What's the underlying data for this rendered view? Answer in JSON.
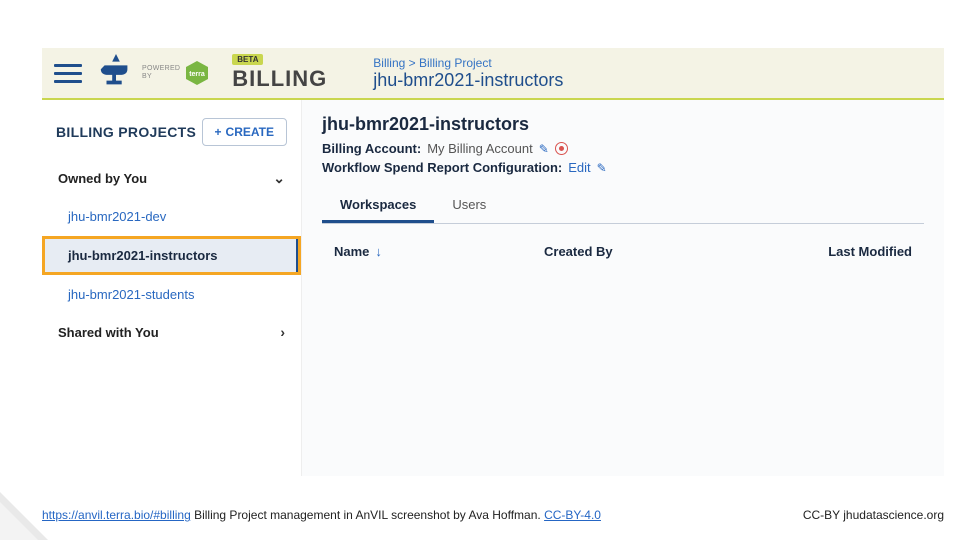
{
  "header": {
    "powered_by": "POWERED\nBY",
    "beta": "BETA",
    "title": "BILLING",
    "breadcrumb_parent": "Billing",
    "breadcrumb_sep": " > ",
    "breadcrumb_current": "Billing Project",
    "subtitle": "jhu-bmr2021-instructors"
  },
  "sidebar": {
    "title": "BILLING PROJECTS",
    "create_label": "CREATE",
    "sections": {
      "owned": "Owned by You",
      "shared": "Shared with You"
    },
    "projects": [
      {
        "name": "jhu-bmr2021-dev",
        "selected": false
      },
      {
        "name": "jhu-bmr2021-instructors",
        "selected": true
      },
      {
        "name": "jhu-bmr2021-students",
        "selected": false
      }
    ]
  },
  "main": {
    "title": "jhu-bmr2021-instructors",
    "billing_account_label": "Billing Account:",
    "billing_account_value": "My Billing Account",
    "workflow_label": "Workflow Spend Report Configuration:",
    "workflow_edit": "Edit",
    "tabs": [
      {
        "label": "Workspaces",
        "active": true
      },
      {
        "label": "Users",
        "active": false
      }
    ],
    "columns": {
      "name": "Name",
      "created": "Created By",
      "modified": "Last Modified"
    }
  },
  "caption": {
    "url": "https://anvil.terra.bio/#billing",
    "text": " Billing Project management in AnVIL screenshot by Ava Hoffman.  ",
    "license": "CC-BY-4.0",
    "attribution": "CC-BY  jhudatascience.org"
  }
}
